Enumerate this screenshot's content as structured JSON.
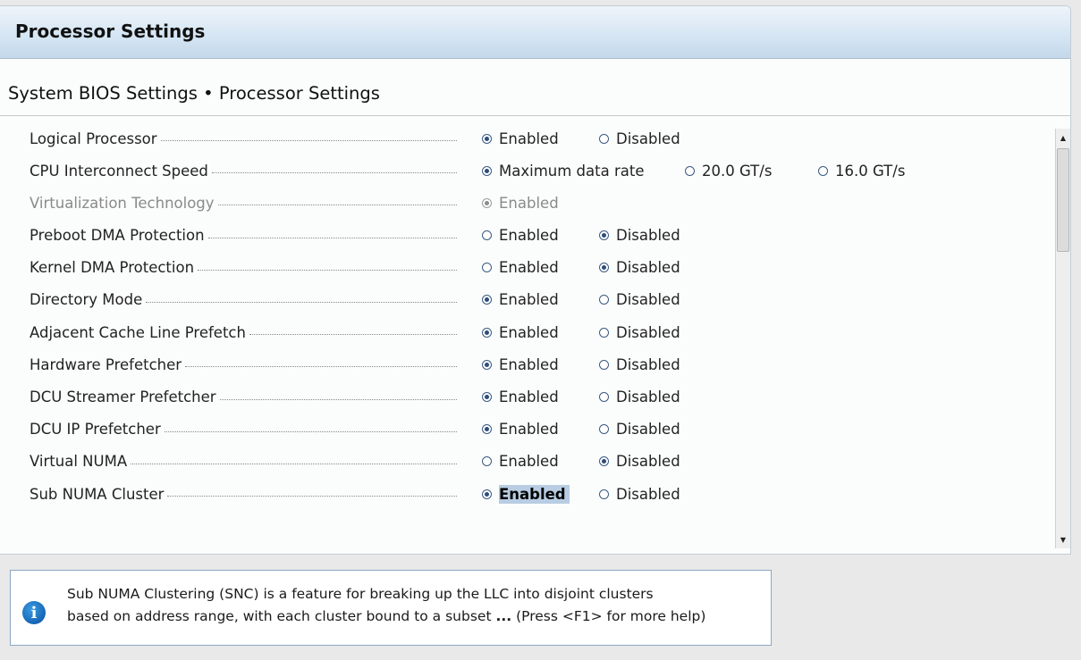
{
  "window": {
    "title": "Processor Settings"
  },
  "breadcrumb": "System BIOS Settings • Processor Settings",
  "settings": [
    {
      "label": "Logical Processor",
      "options": [
        "Enabled",
        "Disabled"
      ],
      "selected": 0
    },
    {
      "label": "CPU Interconnect Speed",
      "options": [
        "Maximum data rate",
        "20.0 GT/s",
        "16.0 GT/s"
      ],
      "selected": 0
    },
    {
      "label": "Virtualization Technology",
      "options": [
        "Enabled"
      ],
      "selected": 0,
      "disabled": true
    },
    {
      "label": "Preboot DMA Protection",
      "options": [
        "Enabled",
        "Disabled"
      ],
      "selected": 1
    },
    {
      "label": "Kernel DMA Protection",
      "options": [
        "Enabled",
        "Disabled"
      ],
      "selected": 1
    },
    {
      "label": "Directory Mode",
      "options": [
        "Enabled",
        "Disabled"
      ],
      "selected": 0
    },
    {
      "label": "Adjacent Cache Line Prefetch",
      "options": [
        "Enabled",
        "Disabled"
      ],
      "selected": 0
    },
    {
      "label": "Hardware Prefetcher",
      "options": [
        "Enabled",
        "Disabled"
      ],
      "selected": 0
    },
    {
      "label": "DCU Streamer Prefetcher",
      "options": [
        "Enabled",
        "Disabled"
      ],
      "selected": 0
    },
    {
      "label": "DCU IP Prefetcher",
      "options": [
        "Enabled",
        "Disabled"
      ],
      "selected": 0
    },
    {
      "label": "Virtual NUMA",
      "options": [
        "Enabled",
        "Disabled"
      ],
      "selected": 1
    },
    {
      "label": "Sub NUMA Cluster",
      "options": [
        "Enabled",
        "Disabled"
      ],
      "selected": 0,
      "focused": true
    }
  ],
  "help": {
    "line1": "Sub NUMA Clustering (SNC) is a feature for breaking up the LLC into disjoint clusters",
    "line2_prefix": "based on address range, with each cluster bound to a subset ",
    "line2_ellipsis": "...",
    "line2_suffix": " (Press <F1> for more help)",
    "icon": "info-icon"
  },
  "colors": {
    "title_gradient_top": "#eef4fa",
    "title_gradient_bottom": "#c4d8ea",
    "radio_on": "#2c4d78",
    "focus_highlight": "#b8cde2",
    "info_icon": "#1566b6"
  },
  "scroll": {
    "position_fraction": 0.0,
    "visible_fraction": 0.25
  }
}
